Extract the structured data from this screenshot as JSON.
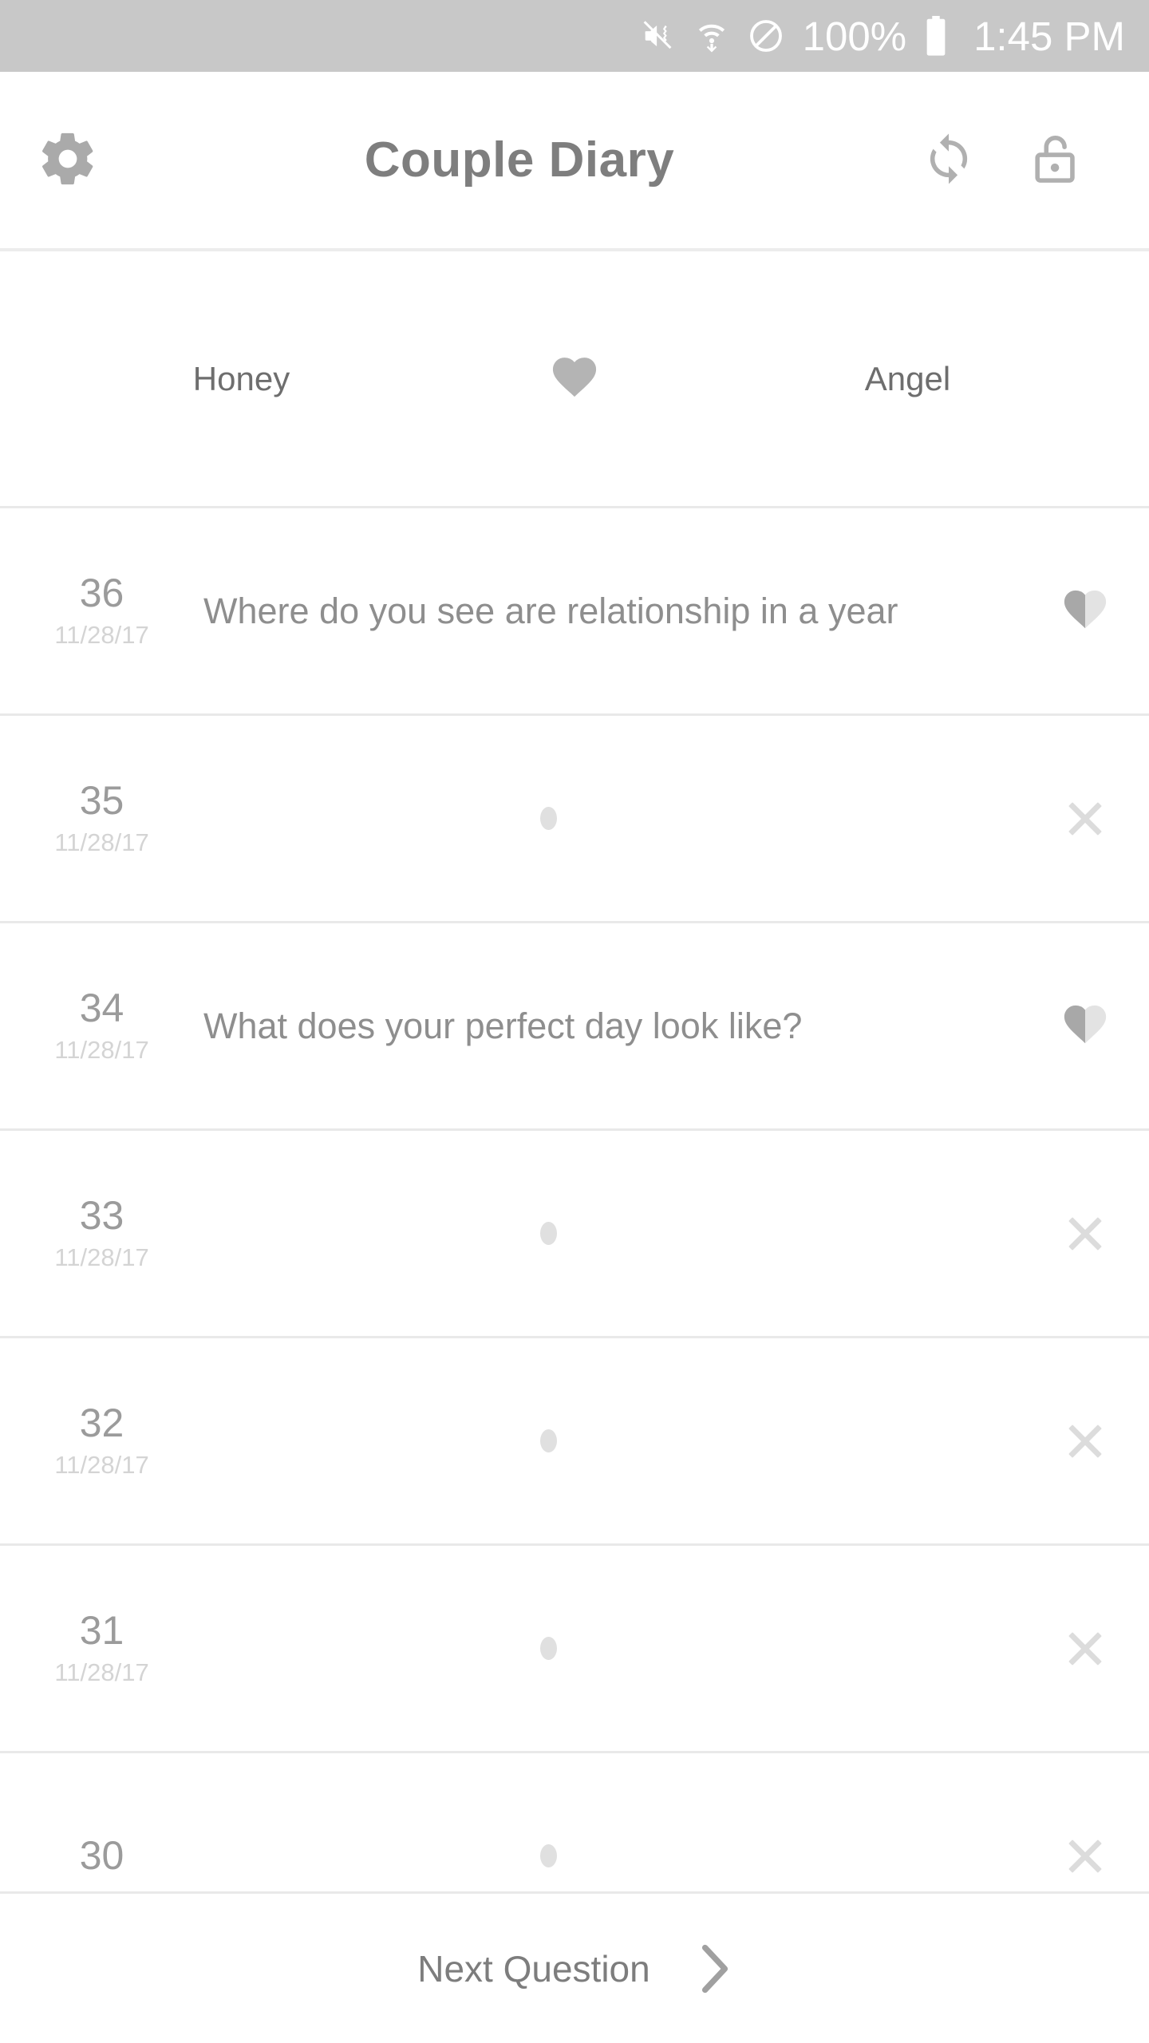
{
  "status_bar": {
    "icons": [
      "volume-mute-vibrate-icon",
      "wifi-icon",
      "do-not-disturb-icon"
    ],
    "battery_percent": "100%",
    "battery_icon": "battery-full-icon",
    "clock": "1:45 PM",
    "background_color": "#c8c8c8",
    "text_color": "#ffffff"
  },
  "app_bar": {
    "settings_icon": "gear-icon",
    "title": "Couple Diary",
    "sync_icon": "sync-icon",
    "lock_icon": "unlock-icon",
    "title_color": "#7e7e7e"
  },
  "partner_header": {
    "left_name": "Honey",
    "heart_icon": "heart-icon",
    "right_name": "Angel",
    "heart_color": "#b4b4b4"
  },
  "question_list": {
    "rows": [
      {
        "index": "36",
        "date": "11/28/17",
        "text": "Where do you see are relationship in a year",
        "status": "half-heart",
        "status_icon": "half-heart-icon"
      },
      {
        "index": "35",
        "date": "11/28/17",
        "text": "",
        "status": "unanswered",
        "status_icon": "close-icon"
      },
      {
        "index": "34",
        "date": "11/28/17",
        "text": "What does your perfect day look like?",
        "status": "half-heart",
        "status_icon": "half-heart-icon"
      },
      {
        "index": "33",
        "date": "11/28/17",
        "text": "",
        "status": "unanswered",
        "status_icon": "close-icon"
      },
      {
        "index": "32",
        "date": "11/28/17",
        "text": "",
        "status": "unanswered",
        "status_icon": "close-icon"
      },
      {
        "index": "31",
        "date": "11/28/17",
        "text": "",
        "status": "unanswered",
        "status_icon": "close-icon"
      },
      {
        "index": "30",
        "date": "",
        "text": "",
        "status": "unanswered",
        "status_icon": "close-icon"
      }
    ],
    "index_color": "#9b9b9b",
    "date_color": "#d4d4d4",
    "text_color": "#8e8e8e",
    "divider_color": "#e9e9e9"
  },
  "footer": {
    "label": "Next Question",
    "chevron_icon": "chevron-right-icon",
    "label_color": "#7d7d7d"
  }
}
